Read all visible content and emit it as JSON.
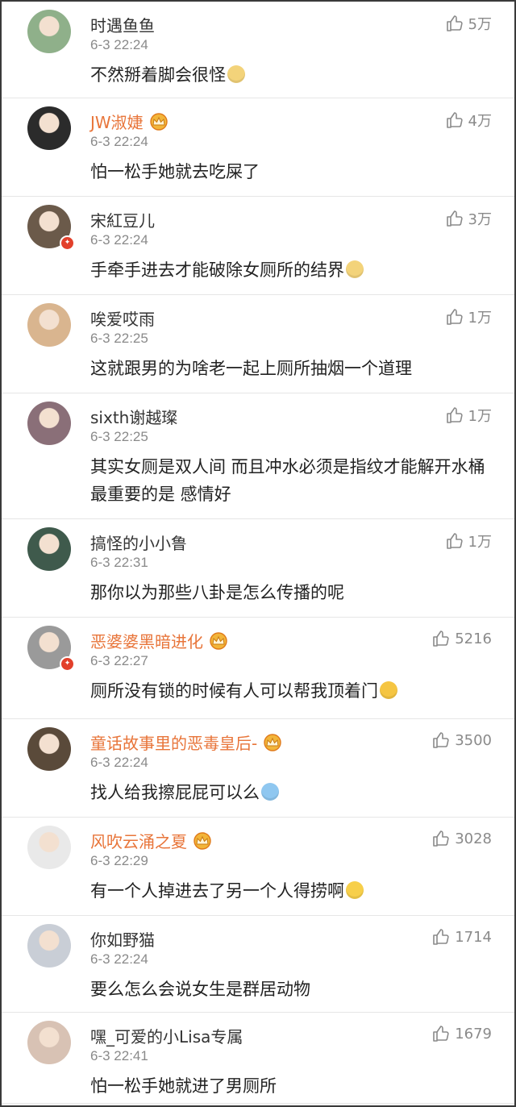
{
  "comments": [
    {
      "name": "时遇鱼鱼",
      "vip": false,
      "time": "6-3 22:24",
      "likes": "5万",
      "text": "不然掰着脚会很怪",
      "emoji": "doge",
      "avatar_color": "#8fb08a",
      "badge": false
    },
    {
      "name": "JW淑婕",
      "vip": true,
      "time": "6-3 22:24",
      "likes": "4万",
      "text": "怕一松手她就去吃屎了",
      "emoji": "",
      "avatar_color": "#2b2b2b",
      "badge": false
    },
    {
      "name": "宋紅豆儿",
      "vip": false,
      "time": "6-3 22:24",
      "likes": "3万",
      "text": "手牵手进去才能破除女厕所的结界",
      "emoji": "doge",
      "avatar_color": "#6b5a4a",
      "badge": true
    },
    {
      "name": "唉爱哎雨",
      "vip": false,
      "time": "6-3 22:25",
      "likes": "1万",
      "text": "这就跟男的为啥老一起上厕所抽烟一个道理",
      "emoji": "",
      "avatar_color": "#d9b58f",
      "badge": false
    },
    {
      "name": "sixth谢越璨",
      "vip": false,
      "time": "6-3 22:25",
      "likes": "1万",
      "text": "其实女厕是双人间 而且冲水必须是指纹才能解开水桶 最重要的是 感情好",
      "emoji": "",
      "avatar_color": "#8a6f78",
      "badge": false
    },
    {
      "name": "搞怪的小小鲁",
      "vip": false,
      "time": "6-3 22:31",
      "likes": "1万",
      "text": "那你以为那些八卦是怎么传播的呢",
      "emoji": "",
      "avatar_color": "#3f5a4c",
      "badge": false
    },
    {
      "name": "恶婆婆黑暗进化",
      "vip": true,
      "time": "6-3 22:27",
      "likes": "5216",
      "text": "厕所没有锁的时候有人可以帮我顶着门",
      "emoji": "laugh-cry",
      "avatar_color": "#9a9a9a",
      "badge": true
    },
    {
      "name": "童话故事里的恶毒皇后-",
      "vip": true,
      "time": "6-3 22:24",
      "likes": "3500",
      "text": "找人给我擦屁屁可以么",
      "emoji": "bath",
      "avatar_color": "#5a4a3a",
      "badge": false
    },
    {
      "name": "风吹云涌之夏",
      "vip": true,
      "time": "6-3 22:29",
      "likes": "3028",
      "text": "有一个人掉进去了另一个人得捞啊",
      "emoji": "smile",
      "avatar_color": "#e9e9e9",
      "badge": false
    },
    {
      "name": "你如野猫",
      "vip": false,
      "time": "6-3 22:24",
      "likes": "1714",
      "text": "要么怎么会说女生是群居动物",
      "emoji": "",
      "avatar_color": "#c9ced6",
      "badge": false
    },
    {
      "name": "嘿_可爱的小Lisa专属",
      "vip": false,
      "time": "6-3 22:41",
      "likes": "1679",
      "text": "怕一松手她就进了男厕所",
      "emoji": "",
      "avatar_color": "#d8c2b4",
      "badge": false
    }
  ],
  "colors": {
    "vip_name": "#e8753a",
    "time": "#8a8a8a",
    "divider": "#e6e6e6"
  }
}
